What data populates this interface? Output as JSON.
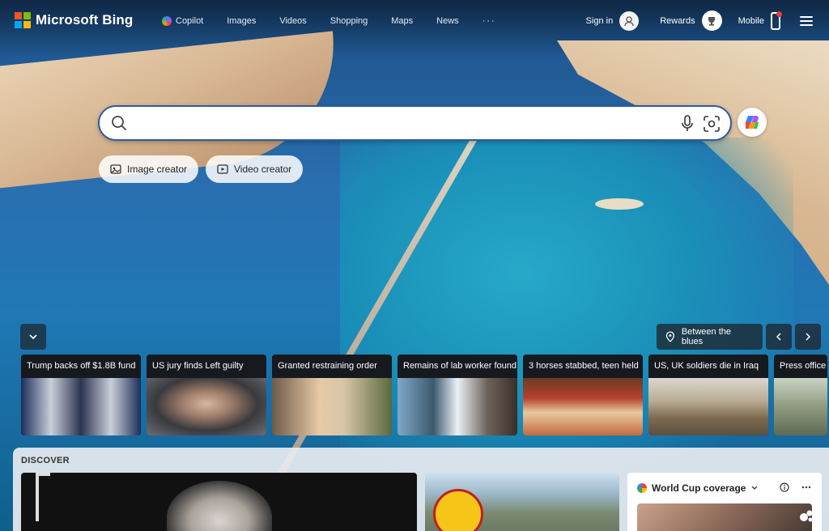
{
  "brand": {
    "name": "Microsoft Bing",
    "logo_colors": [
      "#f35325",
      "#81bc06",
      "#05a6f0",
      "#ffba08"
    ]
  },
  "nav": {
    "items": [
      {
        "label": "Copilot",
        "icon": "copilot-icon"
      },
      {
        "label": "Images"
      },
      {
        "label": "Videos"
      },
      {
        "label": "Shopping"
      },
      {
        "label": "Maps"
      },
      {
        "label": "News"
      }
    ],
    "more_label": "···"
  },
  "account": {
    "signin_label": "Sign in",
    "rewards_label": "Rewards",
    "mobile_label": "Mobile"
  },
  "search": {
    "value": "",
    "placeholder": "",
    "mic_icon": "microphone-icon",
    "visual_icon": "visual-search-icon"
  },
  "chips": [
    {
      "label": "Image creator",
      "icon": "image-creator-icon"
    },
    {
      "label": "Video creator",
      "icon": "video-creator-icon"
    }
  ],
  "background": {
    "location_label": "Between the blues"
  },
  "news": [
    {
      "title": "Trump backs off $1.8B fund"
    },
    {
      "title": "US jury finds Left guilty"
    },
    {
      "title": "Granted restraining order"
    },
    {
      "title": "Remains of lab worker found"
    },
    {
      "title": "3 horses stabbed, teen held"
    },
    {
      "title": "US, UK soldiers die in Iraq"
    },
    {
      "title": "Press office"
    }
  ],
  "discover": {
    "heading": "DISCOVER",
    "side_card": {
      "title": "World Cup coverage"
    }
  }
}
